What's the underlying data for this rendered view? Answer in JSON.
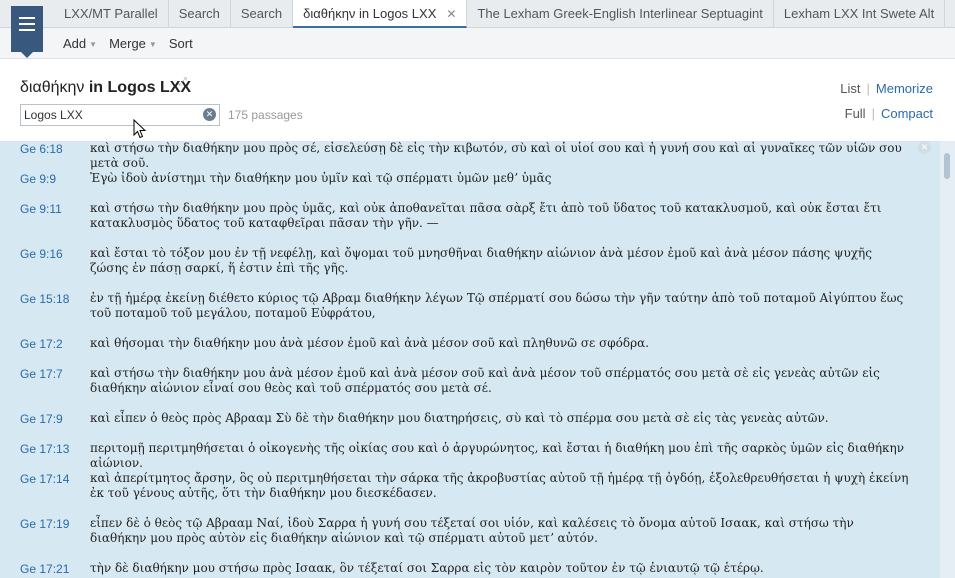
{
  "tabs": [
    {
      "label": "LXX/MT Parallel",
      "active": false
    },
    {
      "label": "Search",
      "active": false
    },
    {
      "label": "Search",
      "active": false
    },
    {
      "label": "διαθήκην in Logos LXX",
      "active": true
    },
    {
      "label": "The Lexham Greek-English Interlinear Septuagint",
      "active": false
    },
    {
      "label": "Lexham LXX Int Swete Alt",
      "active": false
    }
  ],
  "tab_add": "+",
  "tab_close": "✕",
  "toolbar": {
    "add": "Add",
    "merge": "Merge",
    "sort": "Sort"
  },
  "header": {
    "title_term": "διαθήκην",
    "title_rest": " in Logos LXX",
    "list": "List",
    "memorize": "Memorize",
    "full": "Full",
    "compact": "Compact"
  },
  "search": {
    "value": "Logos LXX",
    "count": "175 passages"
  },
  "results": [
    {
      "ref": "Ge 6:18",
      "text": "καὶ στήσω τὴν διαθήκην μου πρὸς σέ, εἰσελεύσῃ δὲ εἰς τὴν κιβωτόν, σὺ καὶ οἱ υἱοί σου καὶ ἡ γυνή σου καὶ αἱ γυναῖκες τῶν υἱῶν σου μετὰ σοῦ."
    },
    {
      "ref": "Ge 9:9",
      "text": "Ἐγὼ ἰδοὺ ἀνίστημι τὴν διαθήκην μου ὑμῖν καὶ τῷ σπέρματι ὑμῶν μεθʼ ὑμᾶς"
    },
    {
      "ref": "Ge 9:11",
      "text": "καὶ στήσω τὴν διαθήκην μου πρὸς ὑμᾶς, καὶ οὐκ ἀποθανεῖται πᾶσα σὰρξ ἔτι ἀπὸ τοῦ ὕδατος τοῦ κατακλυσμοῦ, καὶ οὐκ ἔσται ἔτι κατακλυσμὸς ὕδατος τοῦ καταφθεῖραι πᾶσαν τὴν γῆν. —"
    },
    {
      "ref": "Ge 9:16",
      "text": "καὶ ἔσται τὸ τόξον μου ἐν τῇ νεφέλῃ, καὶ ὄψομαι τοῦ μνησθῆναι διαθήκην αἰώνιον ἀνὰ μέσον ἐμοῦ καὶ ἀνὰ μέσον πάσης ψυχῆς ζώσης ἐν πάσῃ σαρκί, ἥ ἐστιν ἐπὶ τῆς γῆς."
    },
    {
      "ref": "Ge 15:18",
      "text": "ἐν τῇ ἡμέρᾳ ἐκείνῃ διέθετο κύριος τῷ Αβραμ διαθήκην λέγων Τῷ σπέρματί σου δώσω τὴν γῆν ταύτην ἀπὸ τοῦ ποταμοῦ Αἰγύπτου ἕως τοῦ ποταμοῦ τοῦ μεγάλου, ποταμοῦ Εὐφράτου,"
    },
    {
      "ref": "Ge 17:2",
      "text": "καὶ θήσομαι τὴν διαθήκην μου ἀνὰ μέσον ἐμοῦ καὶ ἀνὰ μέσον σοῦ καὶ πληθυνῶ σε σφόδρα."
    },
    {
      "ref": "Ge 17:7",
      "text": "καὶ στήσω τὴν διαθήκην μου ἀνὰ μέσον ἐμοῦ καὶ ἀνὰ μέσον σοῦ καὶ ἀνὰ μέσον τοῦ σπέρματός σου μετὰ σὲ εἰς γενεὰς αὐτῶν εἰς διαθήκην αἰώνιον εἶναί σου θεὸς καὶ τοῦ σπέρματός σου μετὰ σέ."
    },
    {
      "ref": "Ge 17:9",
      "text": "καὶ εἶπεν ὁ θεὸς πρὸς Αβρααμ Σὺ δὲ τὴν διαθήκην μου διατηρήσεις, σὺ καὶ τὸ σπέρμα σου μετὰ σὲ εἰς τὰς γενεὰς αὐτῶν."
    },
    {
      "ref": "Ge 17:13",
      "text": "περιτομῇ περιτμηθήσεται ὁ οἰκογενὴς τῆς οἰκίας σου καὶ ὁ ἀργυρώνητος, καὶ ἔσται ἡ διαθήκη μου ἐπὶ τῆς σαρκὸς ὑμῶν εἰς διαθήκην αἰώνιον."
    },
    {
      "ref": "Ge 17:14",
      "text": "καὶ ἀπερίτμητος ἄρσην, ὃς οὐ περιτμηθήσεται τὴν σάρκα τῆς ἀκροβυστίας αὐτοῦ τῇ ἡμέρᾳ τῇ ὀγδόῃ, ἐξολεθρευθήσεται ἡ ψυχὴ ἐκείνη ἐκ τοῦ γένους αὐτῆς, ὅτι τὴν διαθήκην μου διεσκέδασεν."
    },
    {
      "ref": "Ge 17:19",
      "text": "εἶπεν δὲ ὁ θεὸς τῷ Αβρααμ Ναί, ἰδοὺ Σαρρα ἡ γυνή σου τέξεταί σοι υἱόν, καὶ καλέσεις τὸ ὄνομα αὐτοῦ Ισαακ, καὶ στήσω τὴν διαθήκην μου πρὸς αὐτὸν εἰς διαθήκην αἰώνιον καὶ τῷ σπέρματι αὐτοῦ μετʼ αὐτόν."
    },
    {
      "ref": "Ge 17:21",
      "text": "τὴν δὲ διαθήκην μου στήσω πρὸς Ισαακ, ὃν τέξεταί σοι Σαρρα εἰς τὸν καιρὸν τοῦτον ἐν τῷ ἐνιαυτῷ τῷ ἑτέρῳ."
    }
  ],
  "colors": {
    "accent": "#2a6aa8",
    "app_icon": "#38587d",
    "results_bg": "#d6e9f2"
  }
}
